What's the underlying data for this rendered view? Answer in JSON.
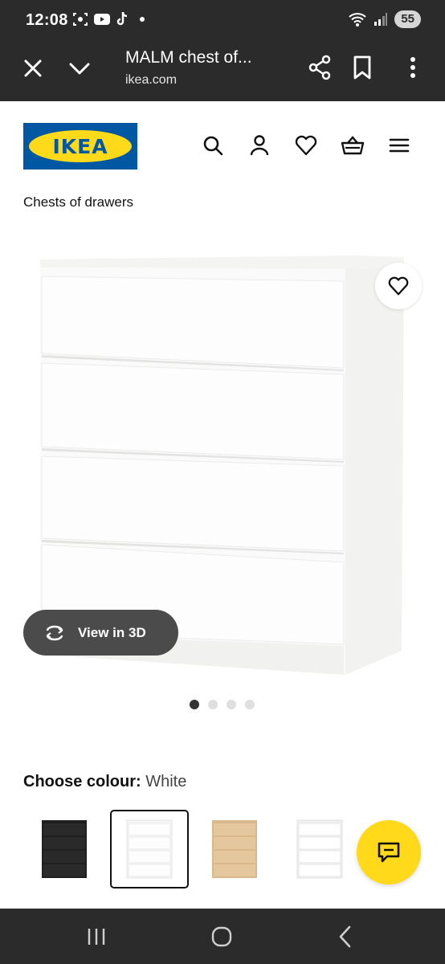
{
  "status_bar": {
    "time": "12:08",
    "battery": "55",
    "icons": [
      "screenshot-icon",
      "youtube-icon",
      "tiktok-icon",
      "wifi-icon",
      "signal-icon"
    ]
  },
  "browser": {
    "page_title": "MALM chest of...",
    "url": "ikea.com"
  },
  "header": {
    "logo_text": "IKEA",
    "icons": [
      "search-icon",
      "account-icon",
      "heart-icon",
      "basket-icon",
      "menu-icon"
    ]
  },
  "breadcrumb": "Chests of drawers",
  "gallery": {
    "view_3d_label": "View in 3D",
    "image_count": 4,
    "active_image": 1
  },
  "colour": {
    "label": "Choose colour:",
    "value": "White",
    "options": [
      "black-brown",
      "white",
      "white stained oak effect",
      "high-gloss white"
    ],
    "selected_index": 1
  },
  "colors": {
    "status_bar_bg": "#2b2b2b",
    "ikea_blue": "#0058a3",
    "ikea_yellow": "#ffda1a",
    "chat_yellow": "#ffd91a"
  }
}
